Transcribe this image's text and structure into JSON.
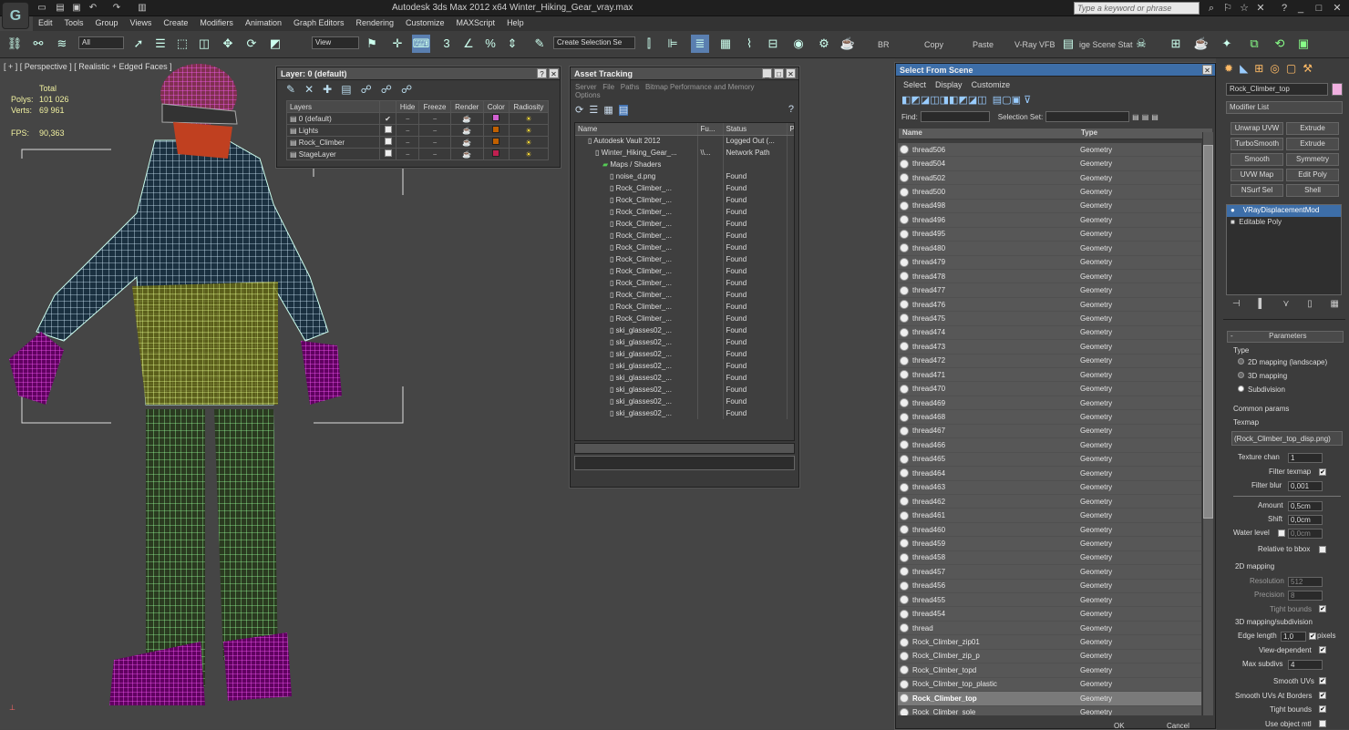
{
  "app": {
    "title": "Autodesk 3ds Max  2012 x64      Winter_Hiking_Gear_vray.max",
    "search_placeholder": "Type a keyword or phrase",
    "logo": "3ds-max-logo"
  },
  "menu": [
    "Edit",
    "Tools",
    "Group",
    "Views",
    "Create",
    "Modifiers",
    "Animation",
    "Graph Editors",
    "Rendering",
    "Customize",
    "MAXScript",
    "Help"
  ],
  "toolbar": {
    "filter": "All",
    "ref_coord": "View",
    "selection_set": "Create Selection Se",
    "copy": "Copy",
    "paste": "Paste",
    "vray_fb": "V-Ray VFB",
    "scene_states": "ige Scene Stat"
  },
  "viewport": {
    "label": "[ + ] [ Perspective ] [ Realistic + Edged Faces ]",
    "stats": {
      "total_label": "Total",
      "polys_label": "Polys:",
      "polys": "101 026",
      "verts_label": "Verts:",
      "verts": "69 961",
      "fps_label": "FPS:",
      "fps": "90,363"
    }
  },
  "layer_panel": {
    "title": "Layer: 0 (default)",
    "headers": [
      "Layers",
      "",
      "Hide",
      "Freeze",
      "Render",
      "Color",
      "Radiosity"
    ],
    "rows": [
      {
        "name": "0 (default)",
        "color": "#d060d0",
        "current": true
      },
      {
        "name": "Lights",
        "color": "#c06000",
        "current": false
      },
      {
        "name": "Rock_Climber",
        "color": "#c06000",
        "current": false
      },
      {
        "name": "StageLayer",
        "color": "#c02050",
        "current": false
      }
    ]
  },
  "asset_panel": {
    "title": "Asset Tracking",
    "menus": [
      "Server",
      "File",
      "Paths",
      "Bitmap Performance and Memory"
    ],
    "menu2": "Options",
    "headers": [
      "Name",
      "Fu...",
      "Status",
      "P"
    ],
    "rows": [
      {
        "name": "Autodesk Vault 2012",
        "full": "",
        "status": "Logged Out (...",
        "indent": 1
      },
      {
        "name": "Winter_Hiking_Gear_...",
        "full": "\\\\...",
        "status": "Network Path",
        "indent": 2
      },
      {
        "name": "Maps / Shaders",
        "full": "",
        "status": "",
        "indent": 3
      },
      {
        "name": "noise_d.png",
        "full": "",
        "status": "Found",
        "indent": 4
      },
      {
        "name": "Rock_Climber_...",
        "full": "",
        "status": "Found",
        "indent": 4
      },
      {
        "name": "Rock_Climber_...",
        "full": "",
        "status": "Found",
        "indent": 4
      },
      {
        "name": "Rock_Climber_...",
        "full": "",
        "status": "Found",
        "indent": 4
      },
      {
        "name": "Rock_Climber_...",
        "full": "",
        "status": "Found",
        "indent": 4
      },
      {
        "name": "Rock_Climber_...",
        "full": "",
        "status": "Found",
        "indent": 4
      },
      {
        "name": "Rock_Climber_...",
        "full": "",
        "status": "Found",
        "indent": 4
      },
      {
        "name": "Rock_Climber_...",
        "full": "",
        "status": "Found",
        "indent": 4
      },
      {
        "name": "Rock_Climber_...",
        "full": "",
        "status": "Found",
        "indent": 4
      },
      {
        "name": "Rock_Climber_...",
        "full": "",
        "status": "Found",
        "indent": 4
      },
      {
        "name": "Rock_Climber_...",
        "full": "",
        "status": "Found",
        "indent": 4
      },
      {
        "name": "Rock_Climber_...",
        "full": "",
        "status": "Found",
        "indent": 4
      },
      {
        "name": "Rock_Climber_...",
        "full": "",
        "status": "Found",
        "indent": 4
      },
      {
        "name": "ski_glasses02_...",
        "full": "",
        "status": "Found",
        "indent": 4
      },
      {
        "name": "ski_glasses02_...",
        "full": "",
        "status": "Found",
        "indent": 4
      },
      {
        "name": "ski_glasses02_...",
        "full": "",
        "status": "Found",
        "indent": 4
      },
      {
        "name": "ski_glasses02_...",
        "full": "",
        "status": "Found",
        "indent": 4
      },
      {
        "name": "ski_glasses02_...",
        "full": "",
        "status": "Found",
        "indent": 4
      },
      {
        "name": "ski_glasses02_...",
        "full": "",
        "status": "Found",
        "indent": 4
      },
      {
        "name": "ski_glasses02_...",
        "full": "",
        "status": "Found",
        "indent": 4
      },
      {
        "name": "ski_glasses02_...",
        "full": "",
        "status": "Found",
        "indent": 4
      }
    ]
  },
  "select_panel": {
    "title": "Select From Scene",
    "menus": [
      "Select",
      "Display",
      "Customize"
    ],
    "find_label": "Find:",
    "selset_label": "Selection Set:",
    "headers": [
      "Name",
      "Type"
    ],
    "ok": "OK",
    "cancel": "Cancel",
    "rows": [
      {
        "name": "thread506",
        "type": "Geometry"
      },
      {
        "name": "thread504",
        "type": "Geometry"
      },
      {
        "name": "thread502",
        "type": "Geometry"
      },
      {
        "name": "thread500",
        "type": "Geometry"
      },
      {
        "name": "thread498",
        "type": "Geometry"
      },
      {
        "name": "thread496",
        "type": "Geometry"
      },
      {
        "name": "thread495",
        "type": "Geometry"
      },
      {
        "name": "thread480",
        "type": "Geometry"
      },
      {
        "name": "thread479",
        "type": "Geometry"
      },
      {
        "name": "thread478",
        "type": "Geometry"
      },
      {
        "name": "thread477",
        "type": "Geometry"
      },
      {
        "name": "thread476",
        "type": "Geometry"
      },
      {
        "name": "thread475",
        "type": "Geometry"
      },
      {
        "name": "thread474",
        "type": "Geometry"
      },
      {
        "name": "thread473",
        "type": "Geometry"
      },
      {
        "name": "thread472",
        "type": "Geometry"
      },
      {
        "name": "thread471",
        "type": "Geometry"
      },
      {
        "name": "thread470",
        "type": "Geometry"
      },
      {
        "name": "thread469",
        "type": "Geometry"
      },
      {
        "name": "thread468",
        "type": "Geometry"
      },
      {
        "name": "thread467",
        "type": "Geometry"
      },
      {
        "name": "thread466",
        "type": "Geometry"
      },
      {
        "name": "thread465",
        "type": "Geometry"
      },
      {
        "name": "thread464",
        "type": "Geometry"
      },
      {
        "name": "thread463",
        "type": "Geometry"
      },
      {
        "name": "thread462",
        "type": "Geometry"
      },
      {
        "name": "thread461",
        "type": "Geometry"
      },
      {
        "name": "thread460",
        "type": "Geometry"
      },
      {
        "name": "thread459",
        "type": "Geometry"
      },
      {
        "name": "thread458",
        "type": "Geometry"
      },
      {
        "name": "thread457",
        "type": "Geometry"
      },
      {
        "name": "thread456",
        "type": "Geometry"
      },
      {
        "name": "thread455",
        "type": "Geometry"
      },
      {
        "name": "thread454",
        "type": "Geometry"
      },
      {
        "name": "thread",
        "type": "Geometry"
      },
      {
        "name": "Rock_Climber_zip01",
        "type": "Geometry"
      },
      {
        "name": "Rock_Climber_zip_p",
        "type": "Geometry"
      },
      {
        "name": "Rock_Climber_topd",
        "type": "Geometry"
      },
      {
        "name": "Rock_Climber_top_plastic",
        "type": "Geometry"
      },
      {
        "name": "Rock_Climber_top",
        "type": "Geometry",
        "selected": true
      },
      {
        "name": "Rock_Climber_sole",
        "type": "Geometry"
      }
    ]
  },
  "command_panel": {
    "object_name": "Rock_Climber_top",
    "object_color": "#f0b0e0",
    "modifier_list": "Modifier List",
    "buttons": [
      "Unwrap UVW",
      "Extrude",
      "TurboSmooth",
      "Extrude",
      "Smooth",
      "Symmetry",
      "UVW Map",
      "Edit Poly",
      "NSurf Sel",
      "Shell"
    ],
    "stack": [
      "VRayDisplacementMod",
      "Editable Poly"
    ],
    "params": {
      "rollout": "Parameters",
      "type_label": "Type",
      "type_options": [
        "2D mapping (landscape)",
        "3D mapping",
        "Subdivision"
      ],
      "selected_type": "Subdivision",
      "common": "Common params",
      "texmap_label": "Texmap",
      "texmap": "(Rock_Climber_top_disp.png)",
      "texture_chan_label": "Texture chan",
      "texture_chan": "1",
      "filter_texmap": "Filter texmap",
      "filter_blur_label": "Filter blur",
      "filter_blur": "0,001",
      "amount_label": "Amount",
      "amount": "0,5cm",
      "shift_label": "Shift",
      "shift": "0,0cm",
      "water_label": "Water level",
      "water": "0,0cm",
      "relative_bbox": "Relative to bbox",
      "mapping2d": "2D mapping",
      "resolution_label": "Resolution",
      "resolution": "512",
      "precision_label": "Precision",
      "precision": "8",
      "tight_bounds": "Tight bounds",
      "mapping3d": "3D mapping/subdivision",
      "edge_length_label": "Edge length",
      "edge_length": "1,0",
      "pixels": "pixels",
      "view_dependent": "View-dependent",
      "max_subdivs_label": "Max subdivs",
      "max_subdivs": "4",
      "smooth_uvs": "Smooth UVs",
      "smooth_uvs_borders": "Smooth UVs At Borders",
      "tight_bounds2": "Tight bounds",
      "use_object_mtl": "Use object mtl"
    }
  }
}
